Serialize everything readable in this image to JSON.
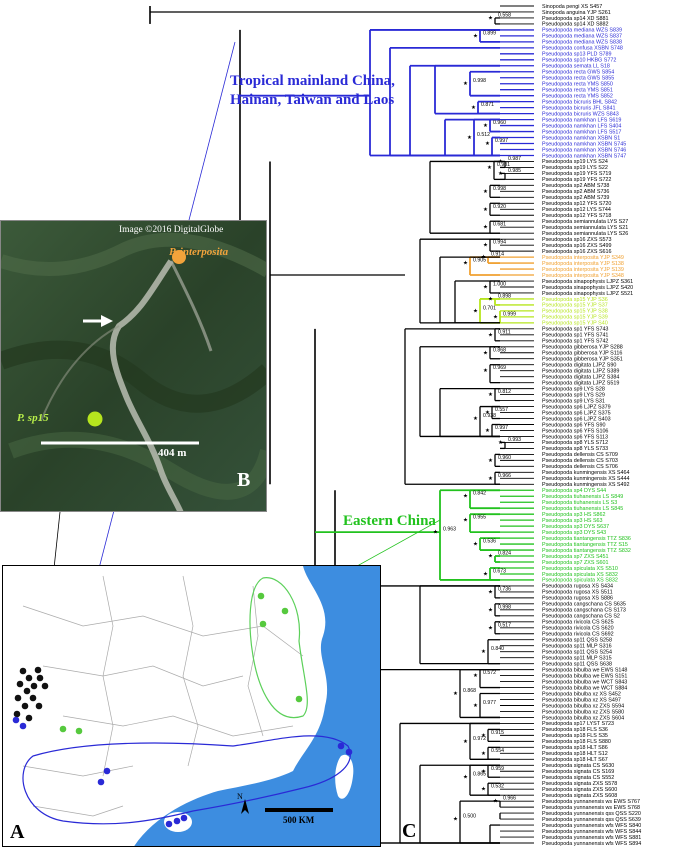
{
  "colors": {
    "black": "#000000",
    "blue": "#2a2ad6",
    "orange": "#f0a030",
    "yellowgreen": "#b6e51e",
    "green": "#22c21e",
    "sea": "#3d8de0"
  },
  "panels": {
    "a": "A",
    "b": "B",
    "c": "C"
  },
  "satellite": {
    "credit": "Image ©2016 DigitalGlobe",
    "label_interposita": "P. interposita",
    "label_sp15": "P. sp15",
    "scale_label": "404 m"
  },
  "map": {
    "scale_label": "500 KM",
    "north": "N"
  },
  "regions": {
    "tropical": [
      "Tropical mainland China,",
      "Hainan, Taiwan and Laos"
    ],
    "eastern": "Eastern China"
  },
  "tree": {
    "tips": [
      {
        "label": "Sinopoda pengi XS S457",
        "color": "black"
      },
      {
        "label": "Sinopoda anguina YJP S261",
        "color": "black"
      },
      {
        "label": "Pseudopoda sp14 XD S881",
        "color": "black"
      },
      {
        "label": "Pseudopoda sp14 XD S882",
        "color": "black"
      },
      {
        "label": "Pseudopoda mediana WZS S839",
        "color": "blue"
      },
      {
        "label": "Pseudopoda mediana WZS S837",
        "color": "blue"
      },
      {
        "label": "Pseudopoda mediana WZS S838",
        "color": "blue"
      },
      {
        "label": "Pseudopoda confusa XSBN S748",
        "color": "blue"
      },
      {
        "label": "Pseudopoda sp13 PLD S789",
        "color": "blue"
      },
      {
        "label": "Pseudopoda sp10 HKBG S772",
        "color": "blue"
      },
      {
        "label": "Pseudopoda semata LL S18",
        "color": "blue"
      },
      {
        "label": "Pseudopoda recta GWS S854",
        "color": "blue"
      },
      {
        "label": "Pseudopoda recta GWS S855",
        "color": "blue"
      },
      {
        "label": "Pseudopoda recta YMS S850",
        "color": "blue"
      },
      {
        "label": "Pseudopoda recta YMS S851",
        "color": "blue"
      },
      {
        "label": "Pseudopoda recta YMS S852",
        "color": "blue"
      },
      {
        "label": "Pseudopoda bicruris BHL S842",
        "color": "blue"
      },
      {
        "label": "Pseudopoda bicruris JFL S841",
        "color": "blue"
      },
      {
        "label": "Pseudopoda bicruris WZS S843",
        "color": "blue"
      },
      {
        "label": "Pseudopoda namkhan LFS S619",
        "color": "blue"
      },
      {
        "label": "Pseudopoda namkhan LFS S404",
        "color": "blue"
      },
      {
        "label": "Pseudopoda namkhan LFS S517",
        "color": "blue"
      },
      {
        "label": "Pseudopoda namkhan XSBN S1",
        "color": "blue"
      },
      {
        "label": "Pseudopoda namkhan XSBN S745",
        "color": "blue"
      },
      {
        "label": "Pseudopoda namkhan XSBN S746",
        "color": "blue"
      },
      {
        "label": "Pseudopoda namkhan XSBN S747",
        "color": "blue"
      },
      {
        "label": "Pseudopoda sp19 LYS S24",
        "color": "black"
      },
      {
        "label": "Pseudopoda sp19 LYS S22",
        "color": "black"
      },
      {
        "label": "Pseudopoda sp19 YFS S719",
        "color": "black"
      },
      {
        "label": "Pseudopoda sp19 YFS S722",
        "color": "black"
      },
      {
        "label": "Pseudopoda sp2 ABM S738",
        "color": "black"
      },
      {
        "label": "Pseudopoda sp2 ABM S736",
        "color": "black"
      },
      {
        "label": "Pseudopoda sp2 ABM S739",
        "color": "black"
      },
      {
        "label": "Pseudopoda sp12 YFS S720",
        "color": "black"
      },
      {
        "label": "Pseudopoda sp12 LYS S744",
        "color": "black"
      },
      {
        "label": "Pseudopoda sp12 YFS S718",
        "color": "black"
      },
      {
        "label": "Pseudopoda semiannulata LYS S27",
        "color": "black"
      },
      {
        "label": "Pseudopoda semiannulata LYS S21",
        "color": "black"
      },
      {
        "label": "Pseudopoda semiannulata LYS S26",
        "color": "black"
      },
      {
        "label": "Pseudopoda sp16 ZXS S573",
        "color": "black"
      },
      {
        "label": "Pseudopoda sp16 ZXS S499",
        "color": "black"
      },
      {
        "label": "Pseudopoda sp16 ZXS S616",
        "color": "black"
      },
      {
        "label": "Pseudopoda interposita YJP S349",
        "color": "orange"
      },
      {
        "label": "Pseudopoda interposita YJP S138",
        "color": "orange"
      },
      {
        "label": "Pseudopoda interposita YJP S139",
        "color": "orange"
      },
      {
        "label": "Pseudopoda interposita YJP S348",
        "color": "orange"
      },
      {
        "label": "Pseudopoda sinapophysis LJPZ S361",
        "color": "black"
      },
      {
        "label": "Pseudopoda sinapophysis LJPZ S420",
        "color": "black"
      },
      {
        "label": "Pseudopoda sinapophysis LJPZ S521",
        "color": "black"
      },
      {
        "label": "Pseudopoda sp15 YJP S36",
        "color": "yellowgreen"
      },
      {
        "label": "Pseudopoda sp15 YJP S37",
        "color": "yellowgreen"
      },
      {
        "label": "Pseudopoda sp15 YJP S38",
        "color": "yellowgreen"
      },
      {
        "label": "Pseudopoda sp15 YJP S39",
        "color": "yellowgreen"
      },
      {
        "label": "Pseudopoda sp15 YJP S40",
        "color": "yellowgreen"
      },
      {
        "label": "Pseudopoda sp1 YFS S743",
        "color": "black"
      },
      {
        "label": "Pseudopoda sp1 YFS S741",
        "color": "black"
      },
      {
        "label": "Pseudopoda sp1 YFS S742",
        "color": "black"
      },
      {
        "label": "Pseudopoda gibberosa YJP S288",
        "color": "black"
      },
      {
        "label": "Pseudopoda gibberosa YJP S116",
        "color": "black"
      },
      {
        "label": "Pseudopoda gibberosa YJP S351",
        "color": "black"
      },
      {
        "label": "Pseudopoda digitata LJPZ S90",
        "color": "black"
      },
      {
        "label": "Pseudopoda digitata LJPZ S389",
        "color": "black"
      },
      {
        "label": "Pseudopoda digitata LJPZ S384",
        "color": "black"
      },
      {
        "label": "Pseudopoda digitata LJPZ S519",
        "color": "black"
      },
      {
        "label": "Pseudopoda sp9 LYS S28",
        "color": "black"
      },
      {
        "label": "Pseudopoda sp9 LYS S29",
        "color": "black"
      },
      {
        "label": "Pseudopoda sp9 LYS S31",
        "color": "black"
      },
      {
        "label": "Pseudopoda sp6 LJPZ S379",
        "color": "black"
      },
      {
        "label": "Pseudopoda sp6 LJPZ S375",
        "color": "black"
      },
      {
        "label": "Pseudopoda sp6 LJPZ S403",
        "color": "black"
      },
      {
        "label": "Pseudopoda sp6 YFS S90",
        "color": "black"
      },
      {
        "label": "Pseudopoda sp6 YFS S106",
        "color": "black"
      },
      {
        "label": "Pseudopoda sp6 YFS S113",
        "color": "black"
      },
      {
        "label": "Pseudopoda sp8 YLS S712",
        "color": "black"
      },
      {
        "label": "Pseudopoda sp8 YLS S733",
        "color": "black"
      },
      {
        "label": "Pseudopoda dellensis CS S709",
        "color": "black"
      },
      {
        "label": "Pseudopoda dellensis CS S703",
        "color": "black"
      },
      {
        "label": "Pseudopoda dellensis CS S706",
        "color": "black"
      },
      {
        "label": "Pseudopoda kunmingensis XS S464",
        "color": "black"
      },
      {
        "label": "Pseudopoda kunmingensis XS S444",
        "color": "black"
      },
      {
        "label": "Pseudopoda kunmingensis XS S492",
        "color": "black"
      },
      {
        "label": "Pseudopoda sp4 DYS S44",
        "color": "green"
      },
      {
        "label": "Pseudopoda tiuhanensis LS S849",
        "color": "green"
      },
      {
        "label": "Pseudopoda tiuhanensis LS S3",
        "color": "green"
      },
      {
        "label": "Pseudopoda tiuhanensis LS S845",
        "color": "green"
      },
      {
        "label": "Pseudopoda sp3 HS S862",
        "color": "green"
      },
      {
        "label": "Pseudopoda sp3 HS S63",
        "color": "green"
      },
      {
        "label": "Pseudopoda sp3 DYS S637",
        "color": "green"
      },
      {
        "label": "Pseudopoda sp3 DYS S43",
        "color": "green"
      },
      {
        "label": "Pseudopoda tiantangensis TTZ S836",
        "color": "green"
      },
      {
        "label": "Pseudopoda tiantangensis TTZ S15",
        "color": "green"
      },
      {
        "label": "Pseudopoda tiantangensis TTZ S832",
        "color": "green"
      },
      {
        "label": "Pseudopoda sp7 ZXS S451",
        "color": "green"
      },
      {
        "label": "Pseudopoda sp7 ZXS S601",
        "color": "green"
      },
      {
        "label": "Pseudopoda spiculata XS S510",
        "color": "green"
      },
      {
        "label": "Pseudopoda spiculata XS S832",
        "color": "green"
      },
      {
        "label": "Pseudopoda spiculata XS S832",
        "color": "green"
      },
      {
        "label": "Pseudopoda rugosa XS S434",
        "color": "black"
      },
      {
        "label": "Pseudopoda rugosa XS S511",
        "color": "black"
      },
      {
        "label": "Pseudopoda rugosa XS S886",
        "color": "black"
      },
      {
        "label": "Pseudopoda cangschana CS S635",
        "color": "black"
      },
      {
        "label": "Pseudopoda cangschana CS S173",
        "color": "black"
      },
      {
        "label": "Pseudopoda cangschana CS S2",
        "color": "black"
      },
      {
        "label": "Pseudopoda rivicola CS S625",
        "color": "black"
      },
      {
        "label": "Pseudopoda rivicola CS S620",
        "color": "black"
      },
      {
        "label": "Pseudopoda rivicola CS S692",
        "color": "black"
      },
      {
        "label": "Pseudopoda sp11 QSS S258",
        "color": "black"
      },
      {
        "label": "Pseudopoda sp11 MLP S316",
        "color": "black"
      },
      {
        "label": "Pseudopoda sp11 QSS S254",
        "color": "black"
      },
      {
        "label": "Pseudopoda sp11 MLP S315",
        "color": "black"
      },
      {
        "label": "Pseudopoda sp11 QSS S638",
        "color": "black"
      },
      {
        "label": "Pseudopoda bibulba we EWS S148",
        "color": "black"
      },
      {
        "label": "Pseudopoda bibulba we EWS S151",
        "color": "black"
      },
      {
        "label": "Pseudopoda bibulba we WCT S843",
        "color": "black"
      },
      {
        "label": "Pseudopoda bibulba we WCT S884",
        "color": "black"
      },
      {
        "label": "Pseudopoda bibulba xz XS S452",
        "color": "black"
      },
      {
        "label": "Pseudopoda bibulba xz XS S497",
        "color": "black"
      },
      {
        "label": "Pseudopoda bibulba xz ZXS S594",
        "color": "black"
      },
      {
        "label": "Pseudopoda bibulba xz ZXS S580",
        "color": "black"
      },
      {
        "label": "Pseudopoda bibulba xz ZXS S604",
        "color": "black"
      },
      {
        "label": "Pseudopoda sp17 LYST S723",
        "color": "black"
      },
      {
        "label": "Pseudopoda sp18 FLS S36",
        "color": "black"
      },
      {
        "label": "Pseudopoda sp18 FLS S35",
        "color": "black"
      },
      {
        "label": "Pseudopoda sp18 FLS S880",
        "color": "black"
      },
      {
        "label": "Pseudopoda sp18 HLT S86",
        "color": "black"
      },
      {
        "label": "Pseudopoda sp18 HLT S12",
        "color": "black"
      },
      {
        "label": "Pseudopoda sp18 HLT S67",
        "color": "black"
      },
      {
        "label": "Pseudopoda signata CS S630",
        "color": "black"
      },
      {
        "label": "Pseudopoda signata CS S169",
        "color": "black"
      },
      {
        "label": "Pseudopoda signata CS S552",
        "color": "black"
      },
      {
        "label": "Pseudopoda signata ZXS S578",
        "color": "black"
      },
      {
        "label": "Pseudopoda signata ZXS S600",
        "color": "black"
      },
      {
        "label": "Pseudopoda signata ZXS S608",
        "color": "black"
      },
      {
        "label": "Pseudopoda yunnanensis ws EWS S767",
        "color": "black"
      },
      {
        "label": "Pseudopoda yunnanensis ws EWS S768",
        "color": "black"
      },
      {
        "label": "Pseudopoda yunnanensis qss QSS S220",
        "color": "black"
      },
      {
        "label": "Pseudopoda yunnanensis qss QSS S639",
        "color": "black"
      },
      {
        "label": "Pseudopoda yunnanensis wfs WFS S840",
        "color": "black"
      },
      {
        "label": "Pseudopoda yunnanensis wfs WFS S844",
        "color": "black"
      },
      {
        "label": "Pseudopoda yunnanensis wfs WFS S881",
        "color": "black"
      },
      {
        "label": "Pseudopoda yunnanensis wfs WFS S894",
        "color": "black"
      }
    ],
    "support_values": [
      "0.558",
      "0.899",
      "0.998",
      "0.871",
      "0.512",
      "0.960",
      "0.997",
      "0.987",
      "0.985",
      "0.981",
      "0.998",
      "0.920",
      "0.681",
      "0.994",
      "0.905",
      "0.914",
      "1.000",
      "0.701",
      "0.898",
      "0.999",
      "0.911",
      "0.868",
      "0.969",
      "0.812",
      "0.938",
      "0.557",
      "0.997",
      "0.993",
      "0.960",
      "0.966",
      "0.963",
      "0.842",
      "0.955",
      "0.536",
      "0.824",
      "0.673",
      "0.736",
      "0.998",
      "0.517",
      "0.840",
      "0.868",
      "0.572",
      "0.977",
      "0.972",
      "0.915",
      "0.554",
      "0.865",
      "0.959",
      "0.532",
      "0.500",
      "0.966"
    ]
  }
}
